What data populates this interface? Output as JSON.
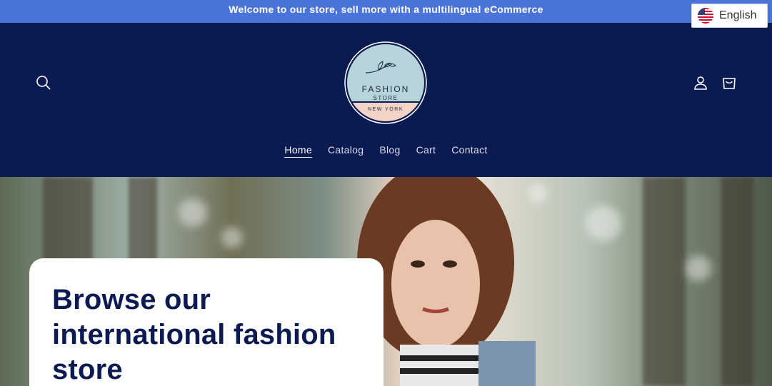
{
  "announcement": {
    "text": "Welcome to our store, sell more with a multilingual eCommerce"
  },
  "language_selector": {
    "label": "English",
    "flag_icon": "us-flag-icon"
  },
  "header": {
    "search_icon": "search-icon",
    "account_icon": "user-icon",
    "cart_icon": "cart-icon",
    "logo": {
      "line1": "FASHION",
      "line2": "STORE",
      "line3": "NEW YORK"
    }
  },
  "nav": {
    "items": [
      {
        "label": "Home",
        "active": true
      },
      {
        "label": "Catalog"
      },
      {
        "label": "Blog"
      },
      {
        "label": "Cart"
      },
      {
        "label": "Contact"
      }
    ]
  },
  "hero": {
    "title": "Browse our international fashion store"
  },
  "colors": {
    "announcement_bg": "#4a74d9",
    "header_bg": "#0c1a52",
    "text_dark": "#0c1a52"
  }
}
